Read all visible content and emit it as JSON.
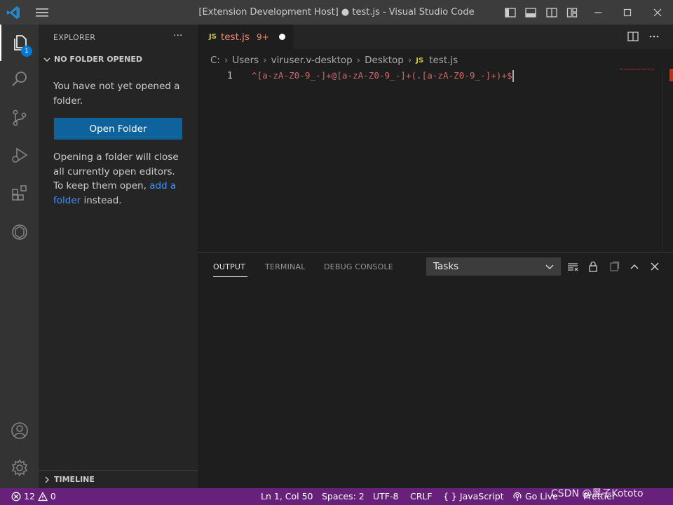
{
  "window": {
    "title": "[Extension Development Host] ● test.js - Visual Studio Code"
  },
  "activity_bar": {
    "explorer_badge": "1"
  },
  "sidebar": {
    "header": "EXPLORER",
    "more": "···",
    "section_title": "NO FOLDER OPENED",
    "message": "You have not yet opened a folder.",
    "open_folder_button": "Open Folder",
    "info_prefix": "Opening a folder will close all currently open editors. To keep them open,",
    "info_link": "add a folder",
    "info_suffix": "instead.",
    "timeline": "TIMELINE"
  },
  "editor": {
    "tab": {
      "icon_label": "JS",
      "name": "test.js",
      "problems": "9+"
    },
    "breadcrumb": [
      "C:",
      "Users",
      "viruser.v-desktop",
      "Desktop",
      "test.js"
    ],
    "breadcrumb_file_icon": "JS",
    "line_number": "1",
    "code": "^[a-zA-Z0-9_-]+@[a-zA-Z0-9_-]+(.[a-zA-Z0-9_-]+)+$"
  },
  "panel": {
    "tabs": [
      "OUTPUT",
      "TERMINAL",
      "DEBUG CONSOLE"
    ],
    "active_tab": "OUTPUT",
    "output_channel": "Tasks"
  },
  "status_bar": {
    "errors": "12",
    "warnings": "0",
    "position": "Ln 1, Col 50",
    "spaces": "Spaces: 2",
    "encoding": "UTF-8",
    "eol": "CRLF",
    "language_icon": "{ }",
    "language": "JavaScript",
    "go_live": "Go Live",
    "prettier": "Prettier",
    "watermark": "CSDN @黑子Kototo"
  },
  "colors": {
    "accent": "#0e639c",
    "status_bar": "#68217a",
    "error_text": "#f48771",
    "link": "#3794ff"
  }
}
